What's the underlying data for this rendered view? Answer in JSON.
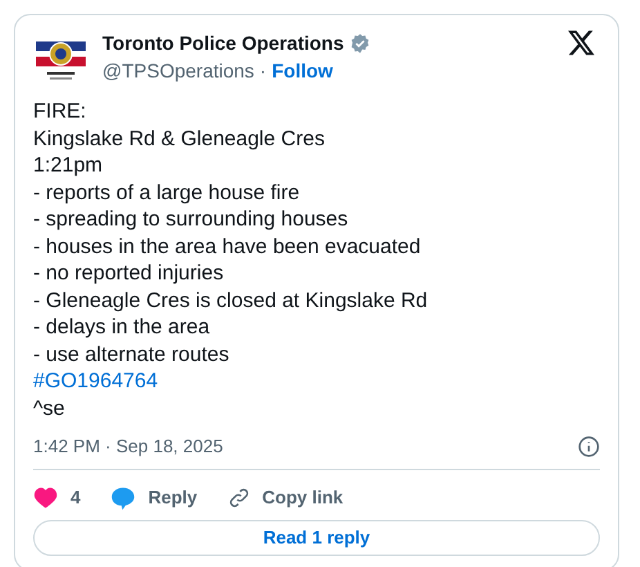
{
  "author": {
    "name": "Toronto Police Operations",
    "handle": "@TPSOperations",
    "separator": "·",
    "follow": "Follow",
    "verified": true
  },
  "lines": [
    {
      "kind": "text",
      "text": "FIRE:"
    },
    {
      "kind": "text",
      "text": "Kingslake Rd & Gleneagle Cres"
    },
    {
      "kind": "text",
      "text": "1:21pm"
    },
    {
      "kind": "text",
      "text": "- reports of a large house fire"
    },
    {
      "kind": "text",
      "text": "- spreading to surrounding houses"
    },
    {
      "kind": "text",
      "text": "- houses in the area have been evacuated"
    },
    {
      "kind": "text",
      "text": "- no reported injuries"
    },
    {
      "kind": "text",
      "text": "- Gleneagle Cres is closed at Kingslake Rd"
    },
    {
      "kind": "text",
      "text": "- delays in the area"
    },
    {
      "kind": "text",
      "text": "- use alternate routes"
    },
    {
      "kind": "hashtag",
      "text": "#GO1964764"
    },
    {
      "kind": "text",
      "text": "^se"
    }
  ],
  "timestamp": "1:42 PM · Sep 18, 2025",
  "actions": [
    {
      "kind": "like",
      "label": "4"
    },
    {
      "kind": "reply",
      "label": "Reply"
    },
    {
      "kind": "copy",
      "label": "Copy link"
    }
  ],
  "read_replies": "Read 1 reply"
}
